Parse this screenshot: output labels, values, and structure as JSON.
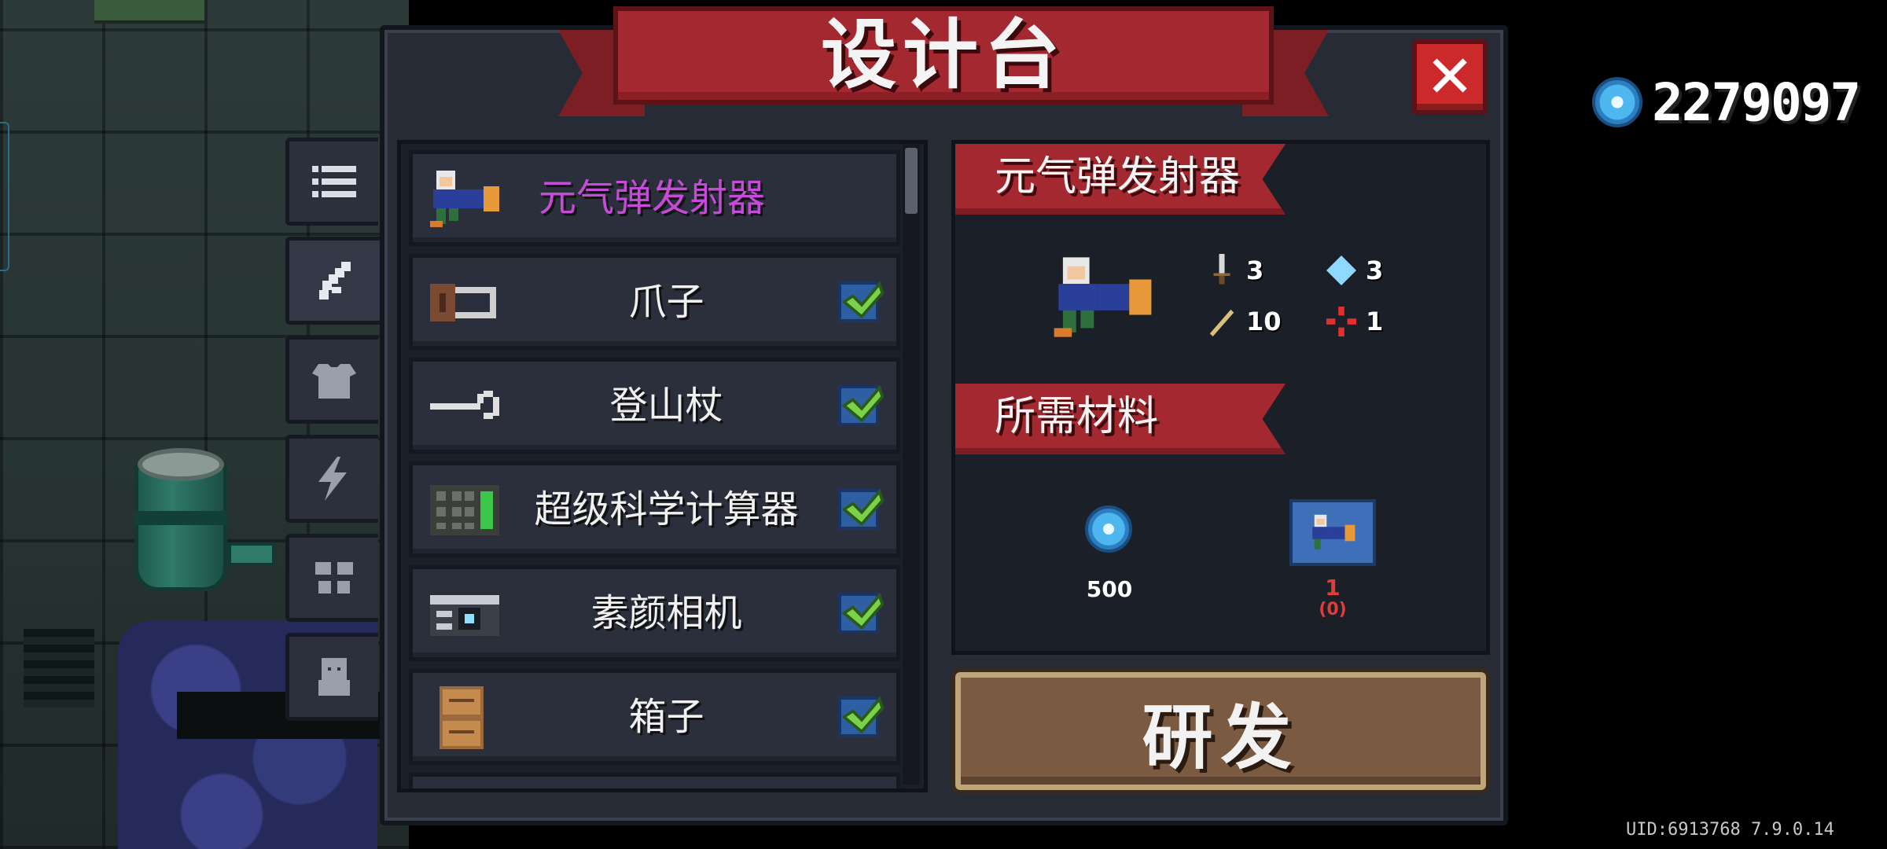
{
  "title": "设计台",
  "close_label": "✕",
  "gems": {
    "count": "2279097",
    "icon": "blue-gem-icon",
    "color": "#4fb7ef"
  },
  "category_tabs": [
    {
      "id": "list",
      "icon": "list-icon"
    },
    {
      "id": "weapons",
      "icon": "weapon-icon",
      "active": true
    },
    {
      "id": "armor",
      "icon": "armor-icon"
    },
    {
      "id": "skills",
      "icon": "lightning-icon"
    },
    {
      "id": "furniture",
      "icon": "furniture-icon"
    },
    {
      "id": "pets",
      "icon": "creature-icon"
    }
  ],
  "items": [
    {
      "name": "元气弹发射器",
      "selected": true,
      "checked": false,
      "icon": "energy-launcher-icon"
    },
    {
      "name": "爪子",
      "checked": true,
      "icon": "claw-icon"
    },
    {
      "name": "登山杖",
      "checked": true,
      "icon": "hiking-stick-icon"
    },
    {
      "name": "超级科学计算器",
      "checked": true,
      "icon": "calculator-icon"
    },
    {
      "name": "素颜相机",
      "checked": true,
      "icon": "camera-icon"
    },
    {
      "name": "箱子",
      "checked": true,
      "icon": "box-icon"
    }
  ],
  "detail": {
    "name": "元气弹发射器",
    "stats": {
      "damage": "3",
      "energy": "3",
      "crit": "10",
      "accuracy": "1"
    },
    "materials_label": "所需材料",
    "materials": [
      {
        "icon": "blue-gem-icon",
        "amount": "500",
        "color": "#ffffff"
      },
      {
        "icon": "blueprint-icon",
        "amount": "1",
        "owned": "(0)",
        "color": "#e23b3b"
      }
    ]
  },
  "research_label": "研发",
  "uid_text": "UID:6913768 7.9.0.14"
}
